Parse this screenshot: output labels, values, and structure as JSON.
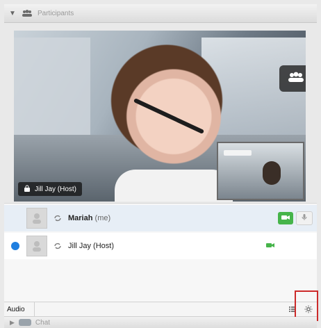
{
  "header": {
    "toggle_icon": "triangle-down-icon",
    "people_icon": "people-icon",
    "title": "Participants"
  },
  "video": {
    "active_speaker_label": "Jill Jay (Host)",
    "layout_button_icon": "people-layout-icon"
  },
  "participants": [
    {
      "avatar_icon": "avatar-icon",
      "status_color": "",
      "sync_icon": "sync-icon",
      "name": "Mariah",
      "suffix": "(me)",
      "camera_color": "#46b44a",
      "has_mic_button": true
    },
    {
      "avatar_icon": "avatar-icon",
      "status_color": "#1f7fe0",
      "sync_icon": "sync-icon",
      "name": "Jill Jay (Host)",
      "suffix": "",
      "camera_color": "#46b44a",
      "has_mic_button": false
    }
  ],
  "audio_bar": {
    "label": "Audio",
    "list_icon": "list-icon",
    "gear_icon": "gear-icon"
  },
  "chat_bar": {
    "label": "Chat",
    "caret_icon": "triangle-right-icon",
    "chat_icon": "chat-icon"
  },
  "colors": {
    "highlight": "#cc2a2a",
    "video_green": "#46b44a",
    "online_blue": "#1f7fe0"
  }
}
